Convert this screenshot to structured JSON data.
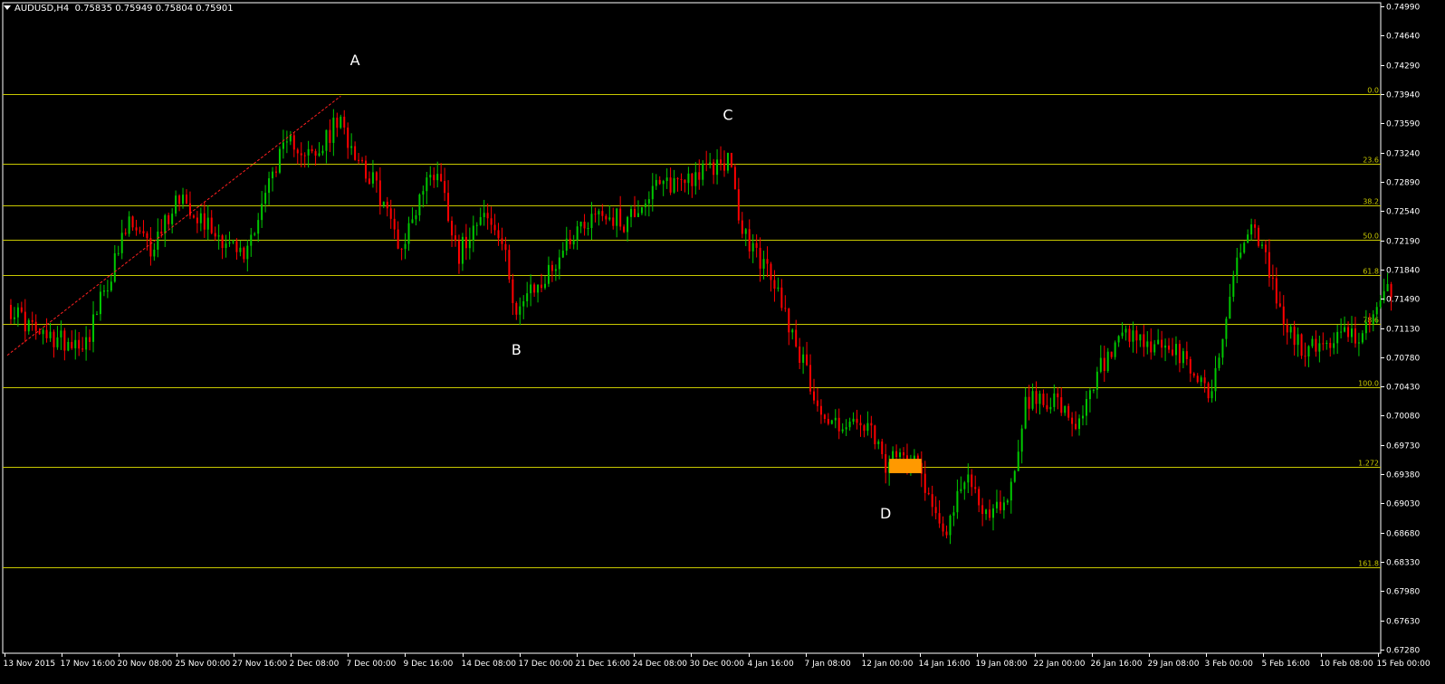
{
  "symbol_header": {
    "symbol": "AUDUSD,H4",
    "ohlc": "0.75835 0.75949 0.75804 0.75901"
  },
  "colors": {
    "background": "#000000",
    "axis": "#ffffff",
    "bull": "#00c800",
    "bear": "#ff0000",
    "fib": "#c8c800",
    "trend": "#ff2020",
    "marker": "#ff9900"
  },
  "chart_data": {
    "type": "candlestick",
    "symbol": "AUDUSD",
    "timeframe": "H4",
    "ylim": [
      0.6726,
      0.7499
    ],
    "grid": false,
    "y_ticks": [
      "0.74990",
      "0.74640",
      "0.74290",
      "0.73940",
      "0.73590",
      "0.73240",
      "0.72890",
      "0.72540",
      "0.72190",
      "0.71840",
      "0.71490",
      "0.71130",
      "0.70780",
      "0.70430",
      "0.70080",
      "0.69730",
      "0.69380",
      "0.69030",
      "0.68680",
      "0.68330",
      "0.67980",
      "0.67630",
      "0.67280"
    ],
    "x_ticks": [
      "13 Nov 2015",
      "17 Nov 16:00",
      "20 Nov 08:00",
      "25 Nov 00:00",
      "27 Nov 16:00",
      "2 Dec 08:00",
      "7 Dec 00:00",
      "9 Dec 16:00",
      "14 Dec 08:00",
      "17 Dec 00:00",
      "21 Dec 16:00",
      "24 Dec 08:00",
      "30 Dec 00:00",
      "4 Jan 16:00",
      "7 Jan 08:00",
      "12 Jan 00:00",
      "14 Jan 16:00",
      "19 Jan 08:00",
      "22 Jan 00:00",
      "26 Jan 16:00",
      "29 Jan 08:00",
      "3 Feb 00:00",
      "5 Feb 16:00",
      "10 Feb 08:00",
      "15 Feb 00:00"
    ],
    "fib_levels": [
      {
        "label": "0.0",
        "price": 0.739
      },
      {
        "label": "23.6",
        "price": 0.7308
      },
      {
        "label": "38.2",
        "price": 0.7258
      },
      {
        "label": "50.0",
        "price": 0.7217
      },
      {
        "label": "61.8",
        "price": 0.7175
      },
      {
        "label": "78.6",
        "price": 0.7117
      },
      {
        "label": "100.0",
        "price": 0.7042
      },
      {
        "label": "1.272",
        "price": 0.6948
      },
      {
        "label": "161.8",
        "price": 0.6828
      }
    ],
    "annotations": [
      {
        "label": "A",
        "candle": 97,
        "price": 0.7425
      },
      {
        "label": "B",
        "candle": 142,
        "price": 0.7081
      },
      {
        "label": "C",
        "candle": 201,
        "price": 0.736
      },
      {
        "label": "D",
        "candle": 245,
        "price": 0.6886
      }
    ],
    "trendline": {
      "from_candle": 0,
      "from_price": 0.708,
      "to_candle": 93,
      "to_price": 0.7388
    },
    "marker": {
      "from_candle": 246,
      "to_candle": 255,
      "price_top": 0.6957,
      "price_bottom": 0.694
    },
    "anchors": [
      [
        0,
        0.714
      ],
      [
        10,
        0.71
      ],
      [
        22,
        0.7097
      ],
      [
        34,
        0.7237
      ],
      [
        40,
        0.7205
      ],
      [
        48,
        0.7272
      ],
      [
        56,
        0.7235
      ],
      [
        66,
        0.7197
      ],
      [
        75,
        0.731
      ],
      [
        80,
        0.7335
      ],
      [
        86,
        0.7312
      ],
      [
        92,
        0.7358
      ],
      [
        97,
        0.7325
      ],
      [
        104,
        0.727
      ],
      [
        110,
        0.7207
      ],
      [
        116,
        0.728
      ],
      [
        120,
        0.7303
      ],
      [
        126,
        0.72
      ],
      [
        132,
        0.7255
      ],
      [
        138,
        0.7212
      ],
      [
        142,
        0.7135
      ],
      [
        150,
        0.717
      ],
      [
        158,
        0.7228
      ],
      [
        165,
        0.7252
      ],
      [
        172,
        0.7238
      ],
      [
        180,
        0.7275
      ],
      [
        188,
        0.729
      ],
      [
        196,
        0.73
      ],
      [
        201,
        0.7315
      ],
      [
        205,
        0.7225
      ],
      [
        210,
        0.7195
      ],
      [
        216,
        0.7145
      ],
      [
        222,
        0.707
      ],
      [
        228,
        0.7002
      ],
      [
        234,
        0.6998
      ],
      [
        240,
        0.6993
      ],
      [
        245,
        0.6948
      ],
      [
        253,
        0.697
      ],
      [
        258,
        0.6898
      ],
      [
        262,
        0.6877
      ],
      [
        268,
        0.6935
      ],
      [
        274,
        0.6885
      ],
      [
        280,
        0.6922
      ],
      [
        284,
        0.7025
      ],
      [
        292,
        0.703
      ],
      [
        298,
        0.6985
      ],
      [
        305,
        0.7065
      ],
      [
        312,
        0.71
      ],
      [
        318,
        0.709
      ],
      [
        324,
        0.709
      ],
      [
        330,
        0.7063
      ],
      [
        336,
        0.7035
      ],
      [
        342,
        0.7175
      ],
      [
        346,
        0.7235
      ],
      [
        351,
        0.7195
      ],
      [
        356,
        0.7115
      ],
      [
        362,
        0.7085
      ],
      [
        368,
        0.7095
      ],
      [
        374,
        0.7105
      ],
      [
        380,
        0.711
      ],
      [
        384,
        0.7148
      ],
      [
        386,
        0.716
      ]
    ]
  }
}
